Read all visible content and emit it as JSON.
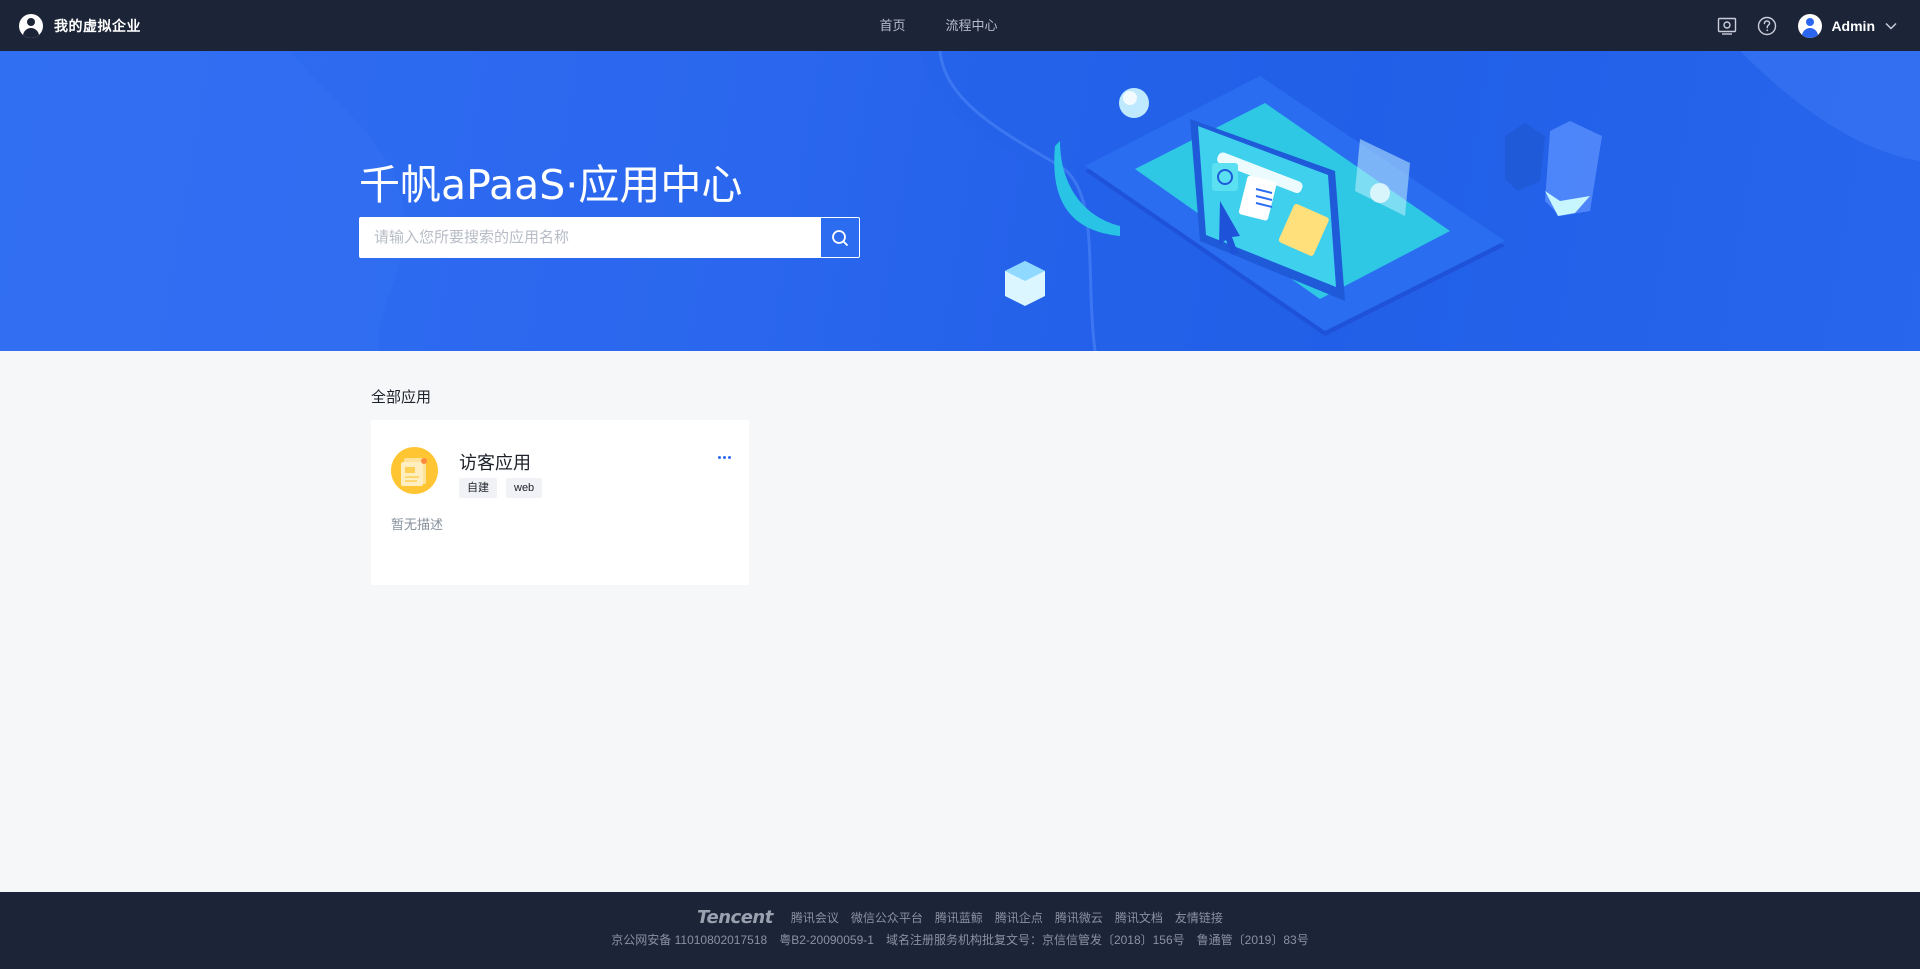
{
  "header": {
    "brand_name": "我的虚拟企业",
    "nav": [
      {
        "label": "首页"
      },
      {
        "label": "流程中心"
      }
    ],
    "icons": [
      "screen-capture-icon",
      "help-icon"
    ],
    "user_name": "Admin"
  },
  "banner": {
    "title": "千帆aPaaS·应用中心",
    "search_placeholder": "请输入您所要搜索的应用名称"
  },
  "main": {
    "section_title": "全部应用",
    "apps": [
      {
        "name": "访客应用",
        "tags": [
          "自建",
          "web"
        ],
        "description": "暂无描述"
      }
    ]
  },
  "footer": {
    "logo_text": "Tencent",
    "links": [
      "腾讯会议",
      "微信公众平台",
      "腾讯蓝鲸",
      "腾讯企点",
      "腾讯微云",
      "腾讯文档",
      "友情链接"
    ],
    "legal": [
      "京公网安备 11010802017518",
      "粤B2-20090059-1",
      "域名注册服务机构批复文号：京信信管发〔2018〕156号",
      "鲁通管〔2019〕83号"
    ]
  },
  "colors": {
    "topbar": "#1c2438",
    "banner": "#2a67ee",
    "accent": "#2c6cf1",
    "app_icon": "#ffc533"
  }
}
